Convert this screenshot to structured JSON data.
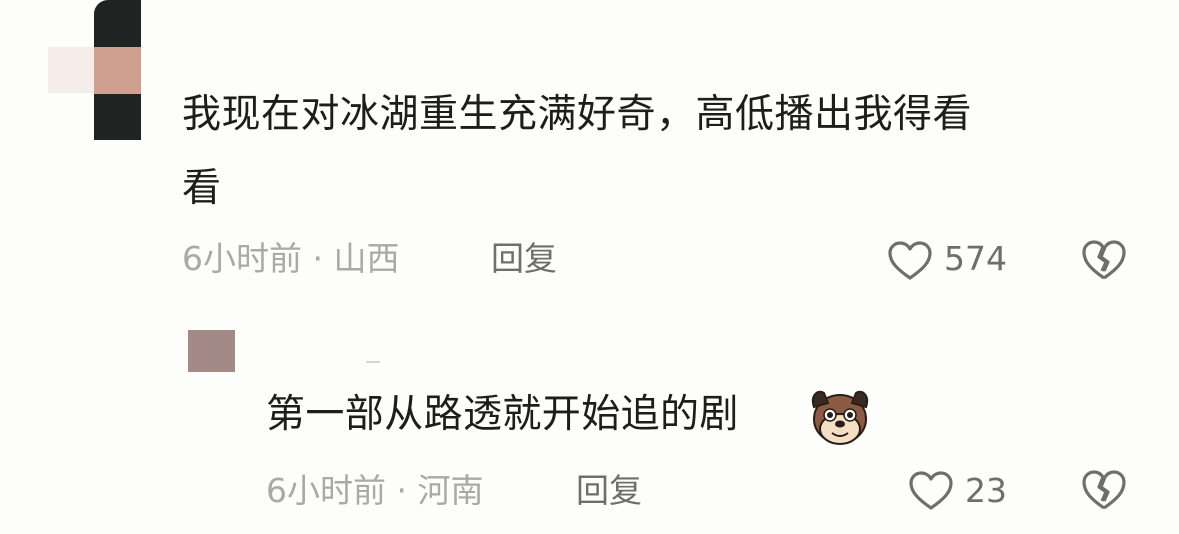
{
  "comments": [
    {
      "text_line1": "我现在对冰湖重生充满好奇，高低播出我得看",
      "text_line2": "看",
      "meta": "6小时前 · 山西",
      "reply_label": "回复",
      "like_count": "574"
    },
    {
      "text": "第一部从路透就开始追的剧",
      "emoji": "dog-emoji",
      "meta": "6小时前 · 河南",
      "reply_label": "回复",
      "like_count": "23"
    }
  ],
  "icons": {
    "like": "heart-outline-icon",
    "dislike": "broken-heart-icon"
  },
  "colors": {
    "background": "#fdfdfb",
    "text": "#1d1d1d",
    "meta": "#a9a9a7",
    "action": "#6e6e6c"
  }
}
